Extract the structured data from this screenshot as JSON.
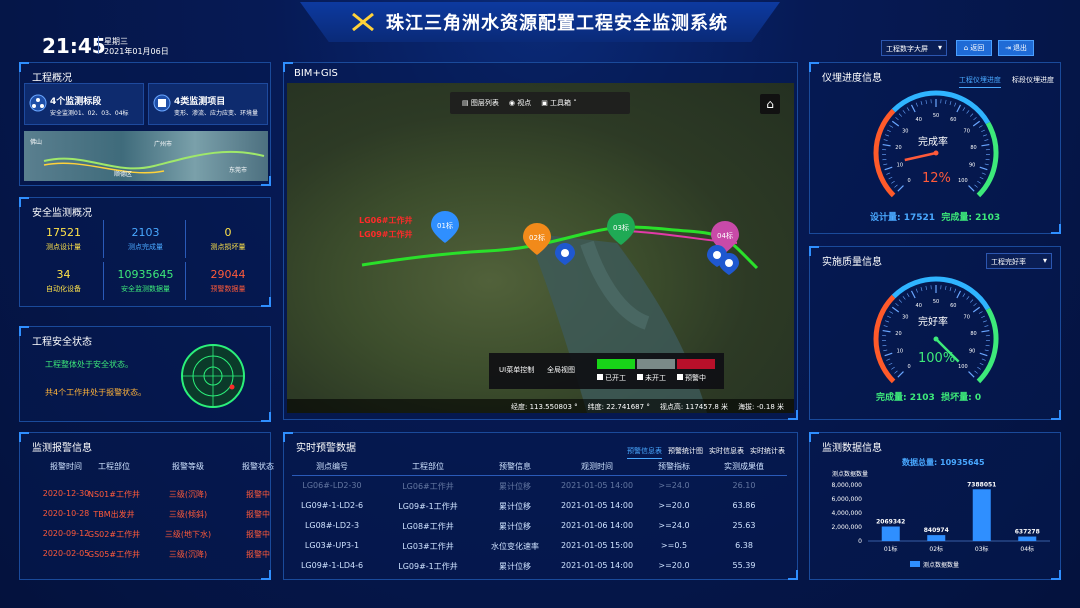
{
  "header": {
    "title": "珠江三角洲水资源配置工程安全监测系统",
    "time": "21:45",
    "weekday": "星期三",
    "date": "2021年01月06日",
    "select_value": "工程数字大屏",
    "btn_back": "返回",
    "btn_exit": "退出"
  },
  "overview": {
    "title": "工程概况",
    "c1_head": "4个监测标段",
    "c1_sub": "安全监测01、02、03、04标",
    "c2_head": "4类监测项目",
    "c2_sub": "变形、渗流、应力应变、环境量",
    "map_labels": [
      "佛山",
      "顺德区",
      "广州市",
      "东莞市"
    ]
  },
  "safety": {
    "title": "安全监测概况",
    "stats": [
      {
        "v": "17521",
        "l": "测点设计量",
        "c": "#ffe34a"
      },
      {
        "v": "2103",
        "l": "测点完成量",
        "c": "#49a8ff"
      },
      {
        "v": "0",
        "l": "测点损坏量",
        "c": "#ffe34a"
      },
      {
        "v": "34",
        "l": "自动化设备",
        "c": "#ffe34a"
      },
      {
        "v": "10935645",
        "l": "安全监测数据量",
        "c": "#3dea7a"
      },
      {
        "v": "29044",
        "l": "预警数据量",
        "c": "#ff5a3a"
      }
    ]
  },
  "status": {
    "title": "工程安全状态",
    "line1": "工程整体处于安全状态。",
    "line2": "共4个工作井处于报警状态。"
  },
  "alarms": {
    "title": "监测报警信息",
    "headers": [
      "报警时间",
      "工程部位",
      "报警等级",
      "报警状态"
    ],
    "rows": [
      [
        "2020-12-30",
        "NS01#工作井",
        "三级(沉降)",
        "报警中"
      ],
      [
        "2020-10-28",
        "TBM出发井",
        "三级(倾斜)",
        "报警中"
      ],
      [
        "2020-09-12",
        "GS02#工作井",
        "三级(地下水)",
        "报警中"
      ],
      [
        "2020-02-05",
        "GS05#工作井",
        "三级(沉降)",
        "报警中"
      ]
    ]
  },
  "map": {
    "title": "BIM+GIS",
    "toolbar": [
      "图层列表",
      "视点",
      "工具箱"
    ],
    "segments": [
      "01标",
      "02标",
      "03标",
      "04标"
    ],
    "wells": [
      "LG06#工作井",
      "LG09#工作井"
    ],
    "legend_title": "UI菜单控制",
    "legend_view": "全局视图",
    "legend_items": [
      "已开工",
      "未开工",
      "预警中"
    ],
    "legend_colors": [
      "#18d418",
      "#7a8a88",
      "#b8102a"
    ],
    "coords": {
      "lon_l": "经度:",
      "lon": "113.550803 °",
      "lat_l": "纬度:",
      "lat": "22.741687 °",
      "h_l": "视点高:",
      "h": "117457.8 米",
      "alt_l": "海拔:",
      "alt": "-0.18 米"
    }
  },
  "realtime": {
    "title": "实时预警数据",
    "tabs": [
      "预警信息表",
      "预警统计图",
      "实时信息表",
      "实时统计表"
    ],
    "headers": [
      "测点编号",
      "工程部位",
      "预警信息",
      "观测时间",
      "预警指标",
      "实测成果值"
    ],
    "rows": [
      [
        "LG06#-LD2-30",
        "LG06#工作井",
        "累计位移",
        "2021-01-05 14:00",
        ">=24.0",
        "26.10"
      ],
      [
        "LG09#-1-LD2-6",
        "LG09#-1工作井",
        "累计位移",
        "2021-01-05 14:00",
        ">=20.0",
        "63.86"
      ],
      [
        "LG08#-LD2-3",
        "LG08#工作井",
        "累计位移",
        "2021-01-06 14:00",
        ">=24.0",
        "25.63"
      ],
      [
        "LG03#-UP3-1",
        "LG03#工作井",
        "水位变化速率",
        "2021-01-05 15:00",
        ">=0.5",
        "6.38"
      ],
      [
        "LG09#-1-LD4-6",
        "LG09#-1工作井",
        "累计位移",
        "2021-01-05 14:00",
        ">=20.0",
        "55.39"
      ]
    ]
  },
  "progress": {
    "title": "仪埋进度信息",
    "tabs": [
      "工程仪埋进度",
      "标段仪埋进度"
    ],
    "gauge_label": "完成率",
    "gauge_value": "12%",
    "gauge_frac": 0.12,
    "design_l": "设计量:",
    "design": "17521",
    "done_l": "完成量:",
    "done": "2103"
  },
  "quality": {
    "title": "实施质量信息",
    "select": "工程完好率",
    "gauge_label": "完好率",
    "gauge_value": "100%",
    "gauge_frac": 1.0,
    "done_l": "完成量:",
    "done": "2103",
    "bad_l": "损坏量:",
    "bad": "0"
  },
  "monitor": {
    "title": "监测数据信息",
    "total_l": "数据总量:",
    "total": "10935645",
    "legend": "测点数据数量"
  },
  "chart_data": {
    "type": "bar",
    "title": "测点数据数量",
    "categories": [
      "01标",
      "02标",
      "03标",
      "04标"
    ],
    "series": [
      {
        "name": "测点数据数量",
        "values": [
          2069342,
          840974,
          7388051,
          637278
        ]
      }
    ],
    "ylim": [
      0,
      8000000
    ],
    "yticks": [
      "8,000,000",
      "6,000,000",
      "4,000,000",
      "2,000,000",
      "0"
    ],
    "color": "#2f8fff"
  }
}
